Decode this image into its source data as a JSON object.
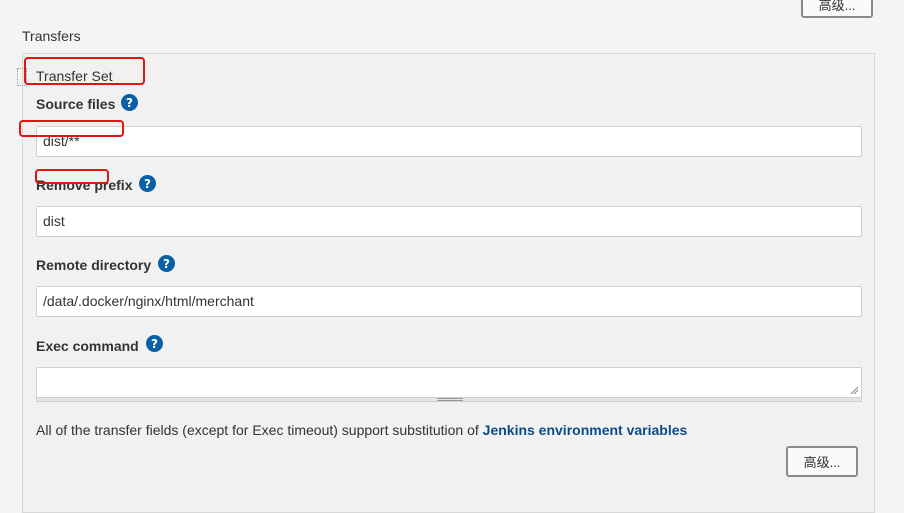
{
  "top_advanced_button": "高级...",
  "transfers_title": "Transfers",
  "transfer_set_title": "Transfer Set",
  "fields": {
    "source_files": {
      "label": "Source files",
      "value": "dist/**"
    },
    "remove_prefix": {
      "label": "Remove prefix",
      "value": "dist"
    },
    "remote_directory": {
      "label": "Remote directory",
      "value": "/data/.docker/nginx/html/merchant"
    },
    "exec_command": {
      "label": "Exec command",
      "value": ""
    }
  },
  "help_icon_glyph": "?",
  "note": {
    "text": "All of the transfer fields (except for Exec timeout) support substitution of ",
    "link": "Jenkins environment variables"
  },
  "bottom_advanced_button": "高级...",
  "colors": {
    "accent": "#0b5fa5",
    "annotation_red": "#e41414",
    "link": "#0b4c86"
  }
}
